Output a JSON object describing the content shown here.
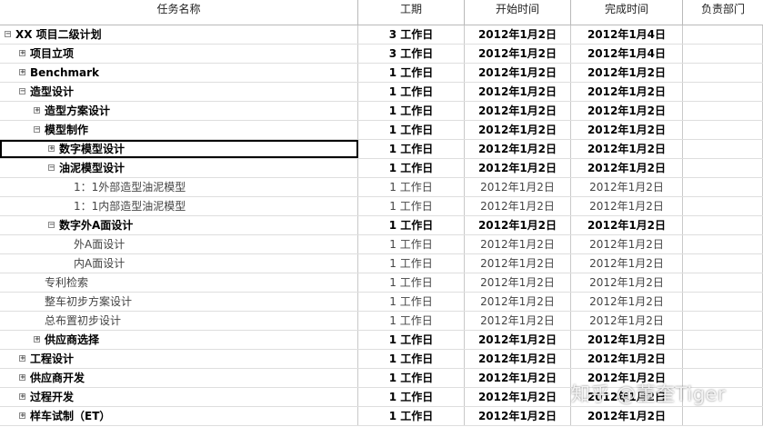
{
  "columns": {
    "name": "任务名称",
    "duration": "工期",
    "start": "开始时间",
    "finish": "完成时间",
    "dept": "负责部门"
  },
  "rows": [
    {
      "name": "XX 项目二级计划",
      "duration": "3 工作日",
      "start": "2012年1月2日",
      "finish": "2012年1月4日",
      "level": 0,
      "toggle": "collapse",
      "bold": true
    },
    {
      "name": "项目立项",
      "duration": "3 工作日",
      "start": "2012年1月2日",
      "finish": "2012年1月4日",
      "level": 1,
      "toggle": "expand",
      "bold": true
    },
    {
      "name": "Benchmark",
      "duration": "1 工作日",
      "start": "2012年1月2日",
      "finish": "2012年1月2日",
      "level": 1,
      "toggle": "expand",
      "bold": true
    },
    {
      "name": "造型设计",
      "duration": "1 工作日",
      "start": "2012年1月2日",
      "finish": "2012年1月2日",
      "level": 1,
      "toggle": "collapse",
      "bold": true
    },
    {
      "name": "造型方案设计",
      "duration": "1 工作日",
      "start": "2012年1月2日",
      "finish": "2012年1月2日",
      "level": 2,
      "toggle": "expand",
      "bold": true
    },
    {
      "name": "模型制作",
      "duration": "1 工作日",
      "start": "2012年1月2日",
      "finish": "2012年1月2日",
      "level": 2,
      "toggle": "collapse",
      "bold": true
    },
    {
      "name": "数字模型设计",
      "duration": "1 工作日",
      "start": "2012年1月2日",
      "finish": "2012年1月2日",
      "level": 3,
      "toggle": "expand",
      "bold": true,
      "selected": true
    },
    {
      "name": "油泥模型设计",
      "duration": "1 工作日",
      "start": "2012年1月2日",
      "finish": "2012年1月2日",
      "level": 3,
      "toggle": "collapse",
      "bold": true
    },
    {
      "name": "1：1外部造型油泥模型",
      "duration": "1 工作日",
      "start": "2012年1月2日",
      "finish": "2012年1月2日",
      "level": 4,
      "toggle": "",
      "bold": false
    },
    {
      "name": "1：1内部造型油泥模型",
      "duration": "1 工作日",
      "start": "2012年1月2日",
      "finish": "2012年1月2日",
      "level": 4,
      "toggle": "",
      "bold": false
    },
    {
      "name": "数字外A面设计",
      "duration": "1 工作日",
      "start": "2012年1月2日",
      "finish": "2012年1月2日",
      "level": 3,
      "toggle": "collapse",
      "bold": true
    },
    {
      "name": "外A面设计",
      "duration": "1 工作日",
      "start": "2012年1月2日",
      "finish": "2012年1月2日",
      "level": 4,
      "toggle": "",
      "bold": false
    },
    {
      "name": "内A面设计",
      "duration": "1 工作日",
      "start": "2012年1月2日",
      "finish": "2012年1月2日",
      "level": 4,
      "toggle": "",
      "bold": false
    },
    {
      "name": "专利检索",
      "duration": "1 工作日",
      "start": "2012年1月2日",
      "finish": "2012年1月2日",
      "level": 2,
      "toggle": "",
      "bold": false
    },
    {
      "name": "整车初步方案设计",
      "duration": "1 工作日",
      "start": "2012年1月2日",
      "finish": "2012年1月2日",
      "level": 2,
      "toggle": "",
      "bold": false
    },
    {
      "name": "总布置初步设计",
      "duration": "1 工作日",
      "start": "2012年1月2日",
      "finish": "2012年1月2日",
      "level": 2,
      "toggle": "",
      "bold": false
    },
    {
      "name": "供应商选择",
      "duration": "1 工作日",
      "start": "2012年1月2日",
      "finish": "2012年1月2日",
      "level": 2,
      "toggle": "expand",
      "bold": true
    },
    {
      "name": "工程设计",
      "duration": "1 工作日",
      "start": "2012年1月2日",
      "finish": "2012年1月2日",
      "level": 1,
      "toggle": "expand",
      "bold": true
    },
    {
      "name": "供应商开发",
      "duration": "1 工作日",
      "start": "2012年1月2日",
      "finish": "2012年1月2日",
      "level": 1,
      "toggle": "expand",
      "bold": true
    },
    {
      "name": "过程开发",
      "duration": "1 工作日",
      "start": "2012年1月2日",
      "finish": "2012年1月2日",
      "level": 1,
      "toggle": "expand",
      "bold": true
    },
    {
      "name": "样车试制（ET）",
      "duration": "1 工作日",
      "start": "2012年1月2日",
      "finish": "2012年1月2日",
      "level": 1,
      "toggle": "expand",
      "bold": true
    }
  ],
  "watermark": "知乎 @董奎Tiger"
}
